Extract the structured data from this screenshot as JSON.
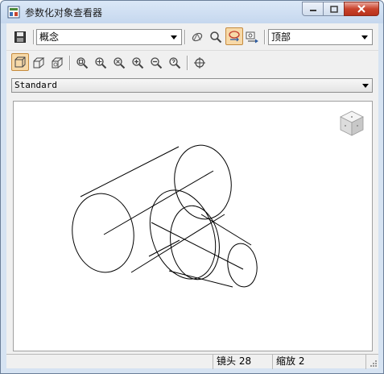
{
  "window": {
    "title": "参数化对象查看器"
  },
  "toolbar": {
    "save_icon": "save-icon",
    "visual_style": {
      "selected": "概念"
    },
    "view_direction": {
      "selected": "顶部"
    },
    "buttons": [
      "orbit-icon",
      "zoom-icon",
      "selection-cycle-icon",
      "settings-export-icon"
    ]
  },
  "toolbar2": {
    "buttons": [
      "box-view-icon",
      "box-perspective-icon",
      "box-wireframe-icon",
      "zoom-window-icon",
      "zoom-extents-icon",
      "zoom-all-icon",
      "zoom-in-icon",
      "zoom-out-icon",
      "zoom-help-icon",
      "pan-target-icon"
    ]
  },
  "style_select": {
    "selected": "Standard"
  },
  "viewcube": {
    "icon": "viewcube-icon"
  },
  "status": {
    "lens": "镜头 28",
    "zoom": "缩放 2"
  },
  "colors": {
    "window_bg": "#f0f0f0",
    "active_button": "#f7d9a8",
    "close_button": "#c9432c"
  }
}
